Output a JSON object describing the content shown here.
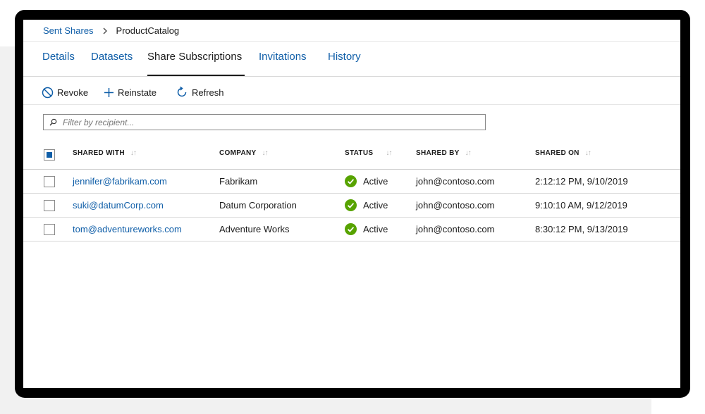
{
  "breadcrumb": {
    "parent": "Sent Shares",
    "current": "ProductCatalog"
  },
  "tabs": [
    {
      "label": "Details"
    },
    {
      "label": "Datasets"
    },
    {
      "label": "Share Subscriptions"
    },
    {
      "label": "Invitations"
    },
    {
      "label": "History"
    }
  ],
  "active_tab": "Share Subscriptions",
  "toolbar": {
    "revoke": "Revoke",
    "reinstate": "Reinstate",
    "refresh": "Refresh"
  },
  "filter": {
    "placeholder": "Filter by recipient..."
  },
  "table": {
    "columns": [
      "SHARED WITH",
      "COMPANY",
      "STATUS",
      "SHARED BY",
      "SHARED ON"
    ],
    "sort_indicator": "↓↑",
    "rows": [
      {
        "shared_with": "jennifer@fabrikam.com",
        "company": "Fabrikam",
        "status": "Active",
        "shared_by": "john@contoso.com",
        "shared_on": "2:12:12 PM, 9/10/2019"
      },
      {
        "shared_with": "suki@datumCorp.com",
        "company": "Datum Corporation",
        "status": "Active",
        "shared_by": "john@contoso.com",
        "shared_on": "9:10:10 AM, 9/12/2019"
      },
      {
        "shared_with": "tom@adventureworks.com",
        "company": "Adventure Works",
        "status": "Active",
        "shared_by": "john@contoso.com",
        "shared_on": "8:30:12 PM, 9/13/2019"
      }
    ]
  },
  "colors": {
    "link": "#0f5ea8",
    "active_status": "#57a300",
    "frame": "#000000"
  }
}
